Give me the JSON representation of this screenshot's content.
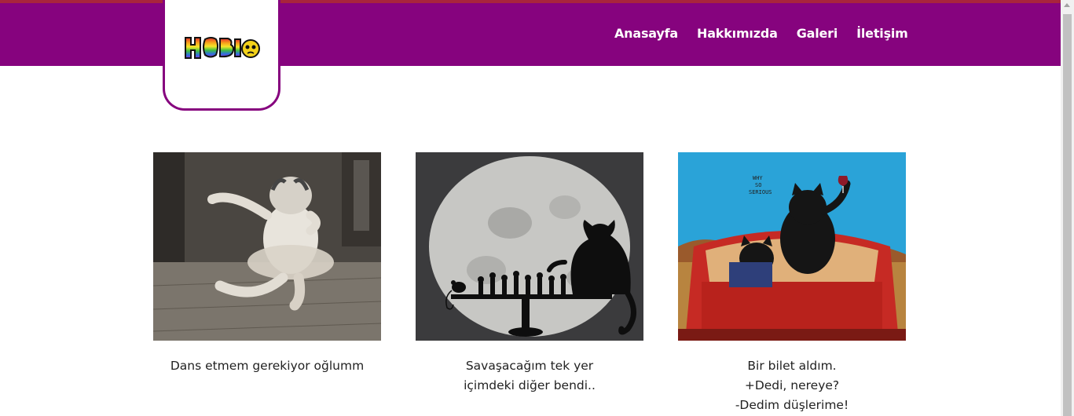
{
  "header": {
    "logo_alt": "HOBI",
    "nav": [
      {
        "label": "Anasayfa"
      },
      {
        "label": "Hakkımızda"
      },
      {
        "label": "Galeri"
      },
      {
        "label": "İletişim"
      }
    ]
  },
  "cards": [
    {
      "image": "dancing-cat-ballet-photo",
      "lines": [
        "Dans etmem gerekiyor oğlumm"
      ]
    },
    {
      "image": "cat-chess-moon-silhouette",
      "lines": [
        "Savaşacağım tek yer",
        "içimdeki diğer bendi.."
      ]
    },
    {
      "image": "cats-red-car-painting",
      "lines": [
        "Bir bilet aldım.",
        "+Dedi, nereye?",
        "-Dedim düşlerime!"
      ]
    }
  ],
  "colors": {
    "brand_purple": "#86037e",
    "top_line": "#a8243c"
  }
}
